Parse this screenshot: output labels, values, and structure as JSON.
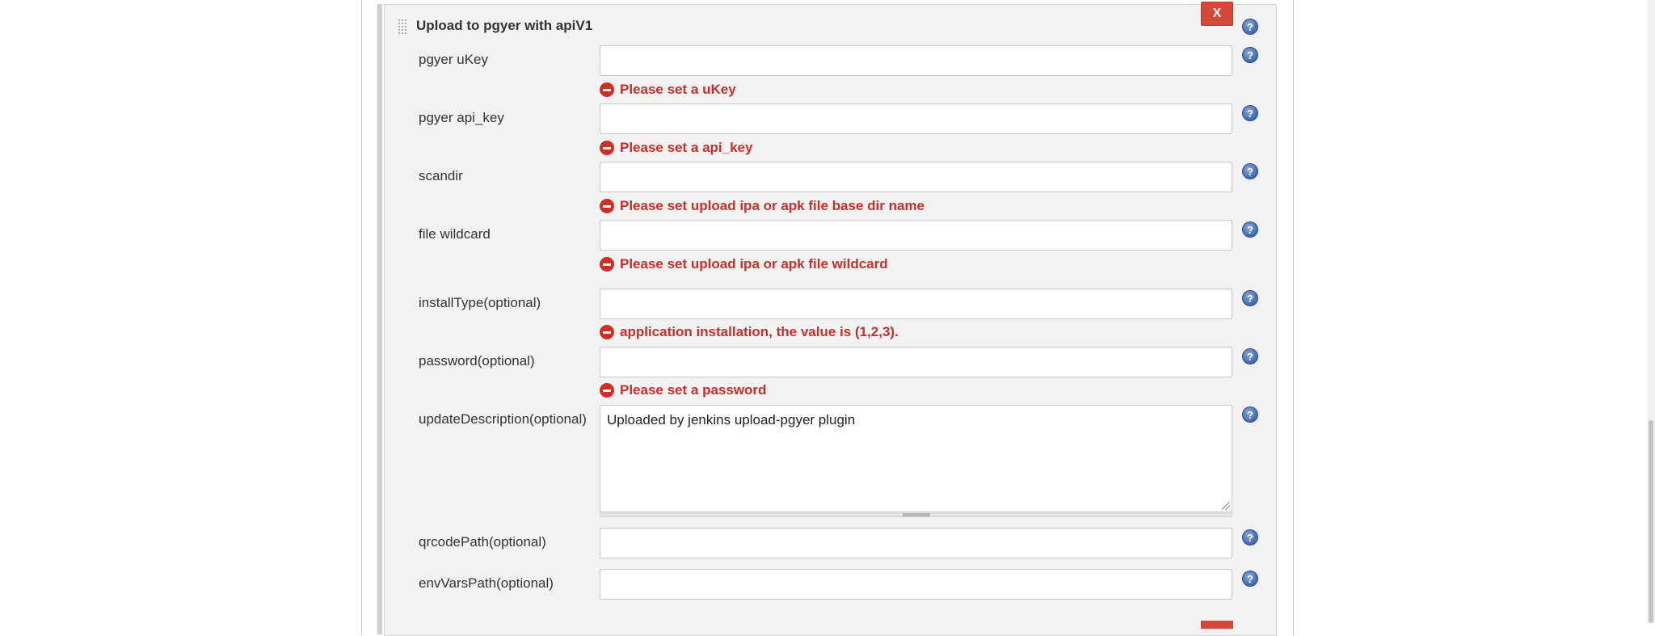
{
  "section": {
    "title": "Upload to pgyer with apiV1",
    "close_label": "X"
  },
  "help_icon": "?",
  "fields": {
    "ukey": {
      "label": "pgyer uKey",
      "value": "",
      "error": "Please set a uKey"
    },
    "api_key": {
      "label": "pgyer api_key",
      "value": "",
      "error": "Please set a api_key"
    },
    "scandir": {
      "label": "scandir",
      "value": "",
      "error": "Please set upload ipa or apk file base dir name"
    },
    "wildcard": {
      "label": "file wildcard",
      "value": "",
      "error": "Please set upload ipa or apk file wildcard"
    },
    "install_type": {
      "label": "installType(optional)",
      "value": "",
      "error": "application installation, the value is (1,2,3)."
    },
    "password": {
      "label": "password(optional)",
      "value": "",
      "error": "Please set a password"
    },
    "update_description": {
      "label": "updateDescription(optional)",
      "value": "Uploaded by jenkins upload-pgyer plugin"
    },
    "qrcode_path": {
      "label": "qrcodePath(optional)",
      "value": ""
    },
    "env_vars_path": {
      "label": "envVarsPath(optional)",
      "value": ""
    }
  },
  "colors": {
    "error_text": "#c4302b",
    "close_button": "#d24939",
    "help_icon": "#3f67a8",
    "panel_bg": "#f2f2f2"
  }
}
